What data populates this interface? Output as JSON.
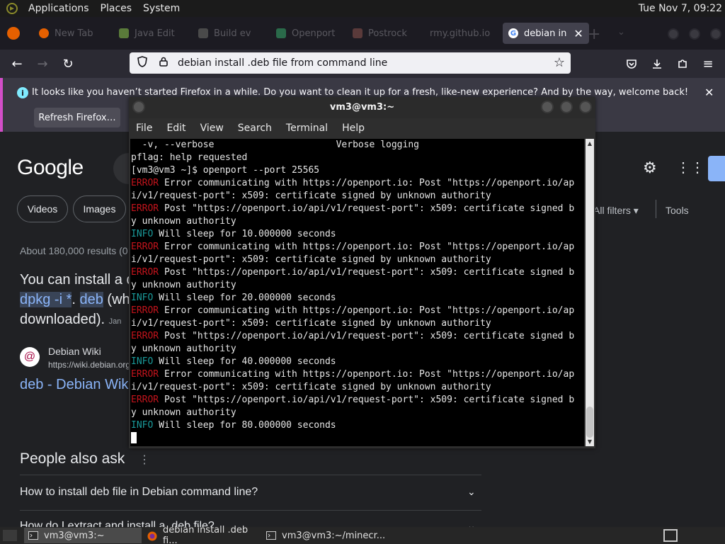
{
  "top_panel": {
    "menus": [
      "Applications",
      "Places",
      "System"
    ],
    "clock": "Tue Nov 7, 09:22"
  },
  "browser": {
    "tabs": [
      {
        "label": "New Tab",
        "fav": "#e66000"
      },
      {
        "label": "Java Edit",
        "fav": "#5a7b3a"
      },
      {
        "label": "Build ev",
        "fav": "#4a4a4a"
      },
      {
        "label": "Openport",
        "fav": "#2a6a4a"
      },
      {
        "label": "Postrock",
        "fav": "#5a3a3a"
      },
      {
        "label": "rmy.github.io",
        "fav": "#1c1b22"
      },
      {
        "label": "debian in",
        "fav": "#ffffff"
      }
    ],
    "address": {
      "url": "debian install .deb file from command line"
    }
  },
  "notification": {
    "message": "It looks like you haven’t started Firefox in a while. Do you want to clean it up for a fresh, like-new experience? And by the way, welcome back!",
    "refresh_label": "Refresh Firefox…"
  },
  "google": {
    "logo": "Google",
    "chips": [
      "Videos",
      "Images"
    ],
    "all_filters": "All filters",
    "tools": "Tools",
    "results_count": "About 180,000 results (0",
    "snippet": {
      "line1": "You can install a d",
      "hl1": "dpkg -i *",
      "dot": ".",
      "hl2": "deb",
      "line2_rest": " (wh",
      "line3": "downloaded).",
      "date": "Jan"
    },
    "site_name": "Debian Wiki",
    "site_url": "https://wiki.debian.org",
    "result_title": "deb - Debian Wiki",
    "people_also_ask": "People also ask",
    "questions": [
      "How to install deb file in Debian command line?",
      "How do I extract and install a .deb file?"
    ]
  },
  "terminal": {
    "title": "vm3@vm3:~",
    "menu": [
      "File",
      "Edit",
      "View",
      "Search",
      "Terminal",
      "Help"
    ],
    "lines": [
      {
        "kind": "plain",
        "text": "  -v, --verbose                      Verbose logging"
      },
      {
        "kind": "plain",
        "text": "pflag: help requested"
      },
      {
        "kind": "plain",
        "text": "[vm3@vm3 ~]$ openport --port 25565"
      },
      {
        "kind": "err",
        "tag": "ERROR",
        "text": " Error communicating with https://openport.io: Post \"https://openport.io/ap"
      },
      {
        "kind": "plain",
        "text": "i/v1/request-port\": x509: certificate signed by unknown authority"
      },
      {
        "kind": "err",
        "tag": "ERROR",
        "text": " Post \"https://openport.io/api/v1/request-port\": x509: certificate signed b"
      },
      {
        "kind": "plain",
        "text": "y unknown authority"
      },
      {
        "kind": "info",
        "tag": "INFO",
        "text": " Will sleep for 10.000000 seconds"
      },
      {
        "kind": "err",
        "tag": "ERROR",
        "text": " Error communicating with https://openport.io: Post \"https://openport.io/ap"
      },
      {
        "kind": "plain",
        "text": "i/v1/request-port\": x509: certificate signed by unknown authority"
      },
      {
        "kind": "err",
        "tag": "ERROR",
        "text": " Post \"https://openport.io/api/v1/request-port\": x509: certificate signed b"
      },
      {
        "kind": "plain",
        "text": "y unknown authority"
      },
      {
        "kind": "info",
        "tag": "INFO",
        "text": " Will sleep for 20.000000 seconds"
      },
      {
        "kind": "err",
        "tag": "ERROR",
        "text": " Error communicating with https://openport.io: Post \"https://openport.io/ap"
      },
      {
        "kind": "plain",
        "text": "i/v1/request-port\": x509: certificate signed by unknown authority"
      },
      {
        "kind": "err",
        "tag": "ERROR",
        "text": " Post \"https://openport.io/api/v1/request-port\": x509: certificate signed b"
      },
      {
        "kind": "plain",
        "text": "y unknown authority"
      },
      {
        "kind": "info",
        "tag": "INFO",
        "text": " Will sleep for 40.000000 seconds"
      },
      {
        "kind": "err",
        "tag": "ERROR",
        "text": " Error communicating with https://openport.io: Post \"https://openport.io/ap"
      },
      {
        "kind": "plain",
        "text": "i/v1/request-port\": x509: certificate signed by unknown authority"
      },
      {
        "kind": "err",
        "tag": "ERROR",
        "text": " Post \"https://openport.io/api/v1/request-port\": x509: certificate signed b"
      },
      {
        "kind": "plain",
        "text": "y unknown authority"
      },
      {
        "kind": "info",
        "tag": "INFO",
        "text": " Will sleep for 80.000000 seconds"
      }
    ]
  },
  "taskbar": {
    "tasks": [
      {
        "label": "vm3@vm3:~",
        "icon": "terminal-icon"
      },
      {
        "label": "debian install .deb fi...",
        "icon": "firefox-icon"
      },
      {
        "label": "vm3@vm3:~/minecr...",
        "icon": "terminal-icon"
      }
    ]
  },
  "colors": {
    "error": "#c4141c",
    "info": "#1a9b9b",
    "notification_accent": "#d24ec8"
  }
}
